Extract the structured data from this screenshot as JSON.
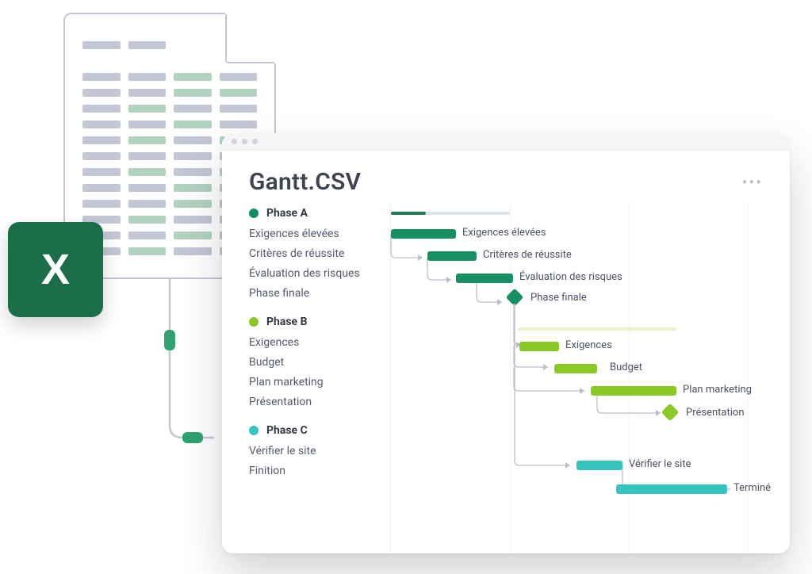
{
  "document_illustration": {
    "badge_letter": "X"
  },
  "window": {
    "title": "Gantt.CSV",
    "more_icon": "•••"
  },
  "phases": {
    "A": {
      "title": "Phase A",
      "tasks": [
        "Exigences élevées",
        "Critères de réussite",
        "Évaluation des risques",
        "Phase finale"
      ],
      "bar_labels": [
        "Exigences élevées",
        "Critères de réussite",
        "Évaluation des risques",
        "Phase finale"
      ]
    },
    "B": {
      "title": "Phase B",
      "tasks": [
        "Exigences",
        "Budget",
        "Plan marketing",
        "Présentation"
      ],
      "bar_labels": [
        "Exigences",
        "Budget",
        "Plan marketing",
        "Présentation"
      ]
    },
    "C": {
      "title": "Phase C",
      "tasks": [
        "Vérifier le site",
        "Finition"
      ],
      "bar_labels": [
        "Vérifier le site",
        "Terminé"
      ]
    }
  },
  "chart_data": {
    "type": "gantt",
    "phases": [
      {
        "name": "Phase A",
        "color": "#168f63",
        "progress": 0.3,
        "tasks": [
          {
            "name": "Exigences élevées",
            "start": 0,
            "end": 82,
            "label": "Exigences élevées"
          },
          {
            "name": "Critères de réussite",
            "start": 46,
            "end": 108,
            "label": "Critères de réussite"
          },
          {
            "name": "Évaluation des risques",
            "start": 82,
            "end": 154,
            "label": "Évaluation des risques"
          },
          {
            "name": "Phase finale",
            "milestone": true,
            "at": 154,
            "label": "Phase finale"
          }
        ]
      },
      {
        "name": "Phase B",
        "color": "#8ac926",
        "tasks": [
          {
            "name": "Exigences",
            "start": 162,
            "end": 212,
            "label": "Exigences"
          },
          {
            "name": "Budget",
            "start": 206,
            "end": 260,
            "label": "Budget"
          },
          {
            "name": "Plan marketing",
            "start": 252,
            "end": 360,
            "label": "Plan marketing"
          },
          {
            "name": "Présentation",
            "milestone": true,
            "at": 352,
            "label": "Présentation"
          }
        ]
      },
      {
        "name": "Phase C",
        "color": "#35c3bf",
        "tasks": [
          {
            "name": "Vérifier le site",
            "start": 234,
            "end": 292,
            "label": "Vérifier le site"
          },
          {
            "name": "Finition",
            "start": 284,
            "end": 424,
            "label": "Terminé"
          }
        ]
      }
    ]
  }
}
